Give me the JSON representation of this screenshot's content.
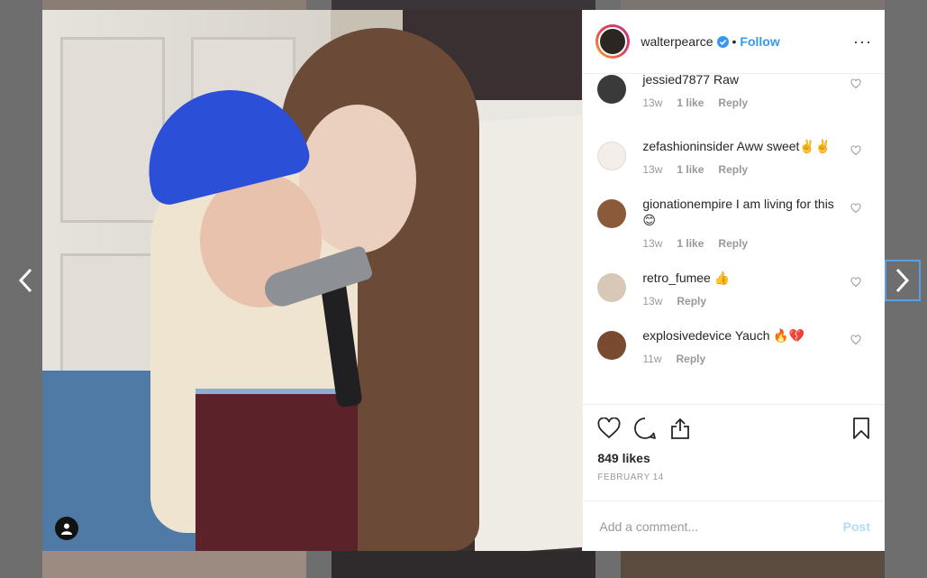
{
  "post": {
    "username": "walterpearce",
    "separator": "•",
    "follow_label": "Follow",
    "more_label": "···",
    "likes": "849 likes",
    "date": "FEBRUARY 14"
  },
  "comments": [
    {
      "user": "jessied7877",
      "text": "Raw",
      "time": "13w",
      "likes": "1 like",
      "reply": "Reply",
      "avatar_color": "#3a3a3a"
    },
    {
      "user": "zefashioninsider",
      "text": "Aww sweet✌️✌️",
      "time": "13w",
      "likes": "1 like",
      "reply": "Reply",
      "avatar_color": "#f4ede8"
    },
    {
      "user": "gionationempire",
      "text": "I am living for this 😊",
      "time": "13w",
      "likes": "1 like",
      "reply": "Reply",
      "avatar_color": "#8a5a3a"
    },
    {
      "user": "retro_fumee",
      "text": "👍",
      "time": "13w",
      "likes": "",
      "reply": "Reply",
      "avatar_color": "#d8c8b8"
    },
    {
      "user": "explosivedevice",
      "text": "Yauch 🔥💔",
      "time": "11w",
      "likes": "",
      "reply": "Reply",
      "avatar_color": "#7a4a30"
    }
  ],
  "composer": {
    "placeholder": "Add a comment...",
    "post_label": "Post"
  },
  "icons": {
    "prev": "chevron-left-icon",
    "next": "chevron-right-icon",
    "like": "heart-icon",
    "comment": "comment-icon",
    "share": "share-icon",
    "save": "bookmark-icon",
    "verified": "verified-badge-icon",
    "tag": "user-tag-icon"
  },
  "colors": {
    "link": "#3897f0",
    "post_disabled": "#b3dbff",
    "overlay": "#6e6e6e"
  }
}
